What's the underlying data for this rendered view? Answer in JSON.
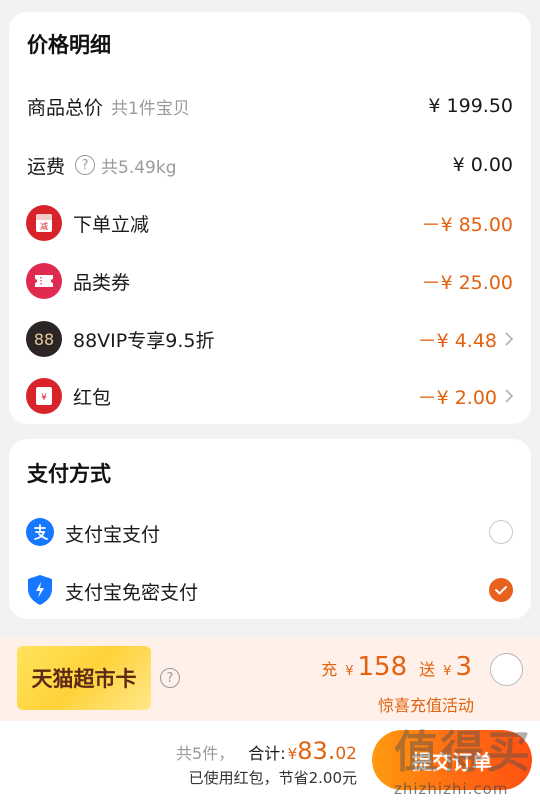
{
  "price_detail": {
    "title": "价格明细",
    "total_label": "商品总价",
    "total_sub": "共1件宝贝",
    "total_amount": "¥ 199.50",
    "shipping_label": "运费",
    "shipping_weight": "共5.49kg",
    "shipping_amount": "¥ 0.00",
    "discounts": [
      {
        "label": "下单立减",
        "amount": "－¥ 85.00",
        "icon": "red-envelope-jian-icon",
        "has_arrow": false
      },
      {
        "label": "品类券",
        "amount": "－¥ 25.00",
        "icon": "coupon-ticket-icon",
        "has_arrow": false
      },
      {
        "label": "88VIP专享9.5折",
        "amount": "－¥ 4.48",
        "icon": "88vip-icon",
        "icon_text": "88",
        "has_arrow": true
      },
      {
        "label": "红包",
        "amount": "－¥ 2.00",
        "icon": "red-packet-icon",
        "has_arrow": true
      }
    ]
  },
  "payment": {
    "title": "支付方式",
    "options": [
      {
        "label": "支付宝支付",
        "icon": "alipay-icon",
        "selected": false
      },
      {
        "label": "支付宝免密支付",
        "icon": "alipay-shield-icon",
        "selected": true
      }
    ]
  },
  "tmall_card": {
    "label": "天猫超市卡",
    "charge_prefix": "充",
    "charge_yen": "¥",
    "charge_amount": "158",
    "gift_prefix": "送",
    "gift_yen": "¥",
    "gift_amount": "3",
    "subtitle": "惊喜充值活动"
  },
  "footer": {
    "count": "共5件，",
    "total_label": "合计:",
    "yen": "¥",
    "total_int": "83.",
    "total_dec": "02",
    "saved": "已使用红包，节省2.00元",
    "submit_label": "提交订单"
  },
  "watermark": {
    "logo": "值得买",
    "url": "zhizhizhi.com"
  },
  "colors": {
    "accent": "#e2620f",
    "submit_gradient_start": "#ff9a10",
    "submit_gradient_end": "#ff5112",
    "card_yellow": "#ffd23a",
    "banner_bg": "#fff0ea"
  }
}
